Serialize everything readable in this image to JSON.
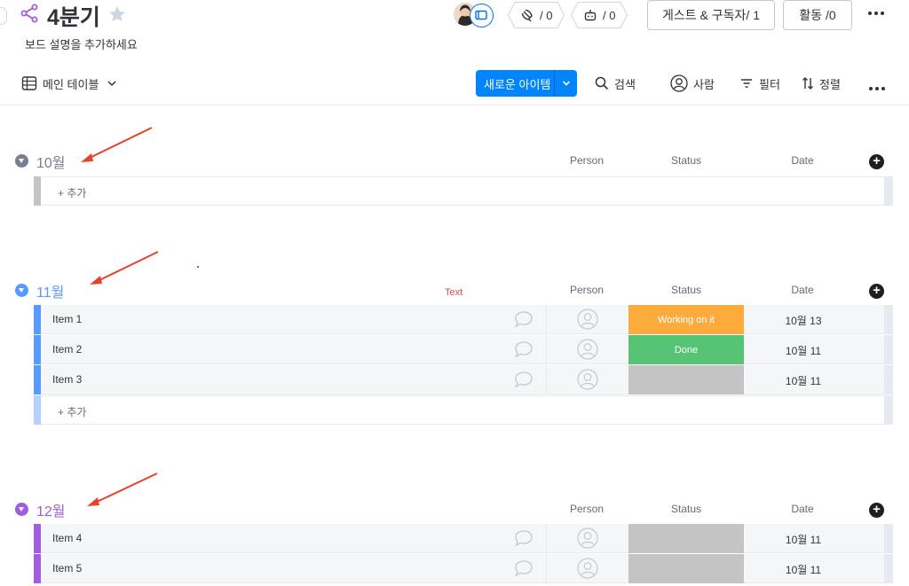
{
  "header": {
    "title": "4분기",
    "description": "보드 설명을 추가하세요",
    "updates_count": "/ 0",
    "automations_count": "/ 0",
    "guests_button": "게스트 & 구독자/ 1",
    "activity_button": "활동 /0"
  },
  "toolbar": {
    "view_label": "메인 테이블",
    "new_item": "새로운 아이템",
    "search": "검색",
    "person": "사람",
    "filter": "필터",
    "sort": "정렬"
  },
  "columns": {
    "person": "Person",
    "status": "Status",
    "date": "Date"
  },
  "colors": {
    "october": "#797e93",
    "november": "#579bfc",
    "december": "#a25ddc",
    "working_on_it": "#fdab3d",
    "done": "#00c875",
    "empty_status": "#c4c4c4",
    "primary": "#0085ff"
  },
  "groups": [
    {
      "title": "10월",
      "add_label": "+ 추가",
      "items": []
    },
    {
      "title": "11월",
      "add_label": "+ 추가",
      "items": [
        {
          "name": "Item 1",
          "status": "Working on it",
          "date": "10월 13"
        },
        {
          "name": "Item 2",
          "status": "Done",
          "date": "10월 11"
        },
        {
          "name": "Item 3",
          "status": "",
          "date": "10월 11"
        }
      ]
    },
    {
      "title": "12월",
      "items": [
        {
          "name": "Item 4",
          "status": "",
          "date": "10월 11"
        },
        {
          "name": "Item 5",
          "status": "",
          "date": "10월 11"
        }
      ]
    }
  ],
  "annotation": {
    "text": "Text"
  }
}
